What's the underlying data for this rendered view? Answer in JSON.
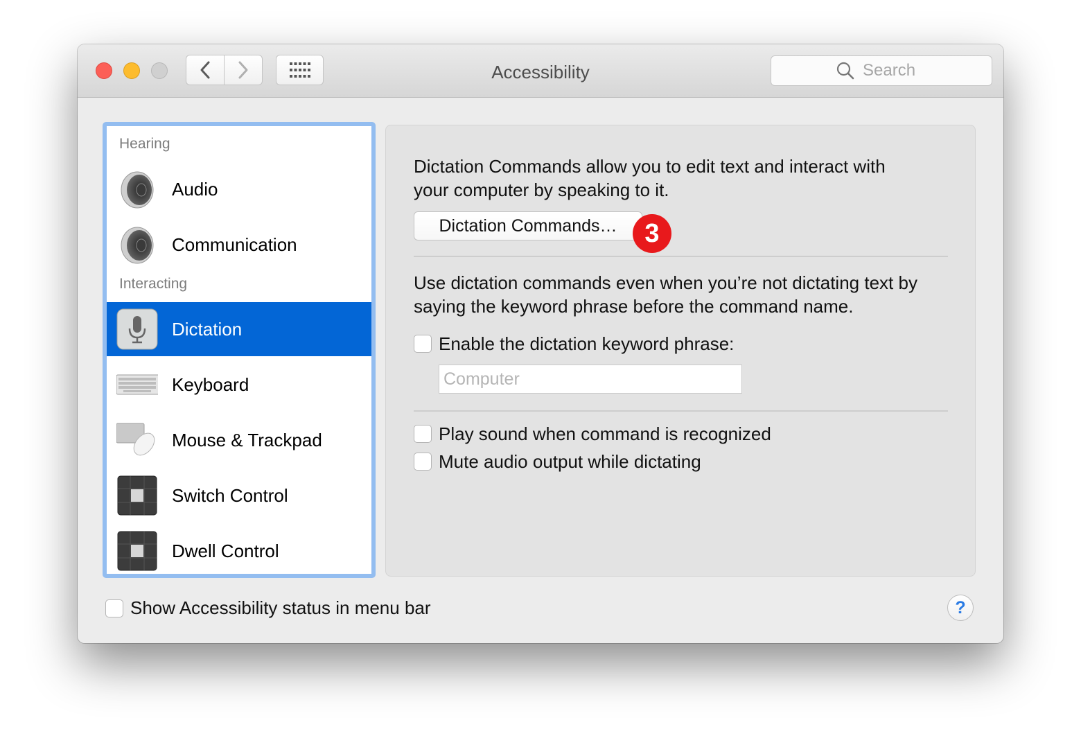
{
  "window": {
    "title": "Accessibility",
    "search_placeholder": "Search"
  },
  "sidebar": {
    "sections": [
      {
        "label": "Hearing",
        "items": [
          {
            "label": "Audio",
            "icon": "speaker-icon"
          },
          {
            "label": "Communication",
            "icon": "speaker-icon"
          }
        ]
      },
      {
        "label": "Interacting",
        "items": [
          {
            "label": "Dictation",
            "icon": "microphone-icon",
            "selected": true
          },
          {
            "label": "Keyboard",
            "icon": "keyboard-icon"
          },
          {
            "label": "Mouse & Trackpad",
            "icon": "mouse-trackpad-icon"
          },
          {
            "label": "Switch Control",
            "icon": "switch-control-icon"
          },
          {
            "label": "Dwell Control",
            "icon": "dwell-control-icon"
          }
        ]
      }
    ]
  },
  "panel": {
    "intro_line1": "Dictation Commands allow you to edit text and interact with",
    "intro_line2": "your computer by speaking to it.",
    "commands_button": "Dictation Commands…",
    "step_badge": "3",
    "keyword_line1": "Use dictation commands even when you’re not dictating text by",
    "keyword_line2": "saying the keyword phrase before the command name.",
    "enable_keyword_label": "Enable the dictation keyword phrase:",
    "enable_keyword_checked": false,
    "keyword_placeholder": "Computer",
    "play_sound_label": "Play sound when command is recognized",
    "play_sound_checked": false,
    "mute_audio_label": "Mute audio output while dictating",
    "mute_audio_checked": false
  },
  "footer": {
    "show_status_label": "Show Accessibility status in menu bar",
    "show_status_checked": false,
    "help_label": "?"
  },
  "colors": {
    "selection": "#0366d6",
    "sidebar_focus_ring": "#93bdf0",
    "badge": "#e8191c",
    "close_light": "#fc5f57",
    "minimize_light": "#fdbc2e",
    "zoom_light_disabled": "#d0d0d0"
  }
}
